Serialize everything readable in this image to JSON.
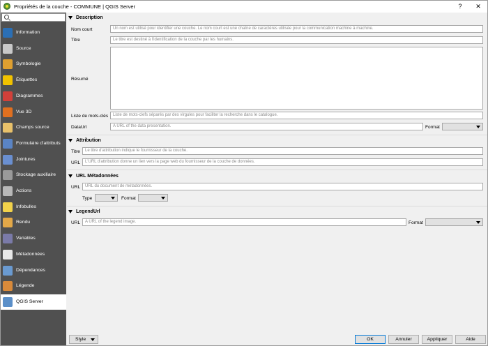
{
  "window": {
    "title": "Propriétés de la couche - COMMUNE | QGIS Server",
    "help_glyph": "?",
    "close_glyph": "✕"
  },
  "sidebar": {
    "search_placeholder": "",
    "items": [
      {
        "label": "Information",
        "icon": "info-icon",
        "color": "#2b6fb5"
      },
      {
        "label": "Source",
        "icon": "source-wrench-icon",
        "color": "#c9c9c9"
      },
      {
        "label": "Symbologie",
        "icon": "symbology-brush-icon",
        "color": "#e0a030"
      },
      {
        "label": "Étiquettes",
        "icon": "labels-abc-icon",
        "color": "#f2c200"
      },
      {
        "label": "Diagrammes",
        "icon": "diagram-icon",
        "color": "#d2403a"
      },
      {
        "label": "Vue 3D",
        "icon": "view-3d-icon",
        "color": "#e07020"
      },
      {
        "label": "Champs source",
        "icon": "source-fields-icon",
        "color": "#e8c16a"
      },
      {
        "label": "Formulaire d'attributs",
        "icon": "attribute-form-icon",
        "color": "#5a84c4"
      },
      {
        "label": "Jointures",
        "icon": "joins-icon",
        "color": "#6a8fd0"
      },
      {
        "label": "Stockage auxiliaire",
        "icon": "auxiliary-storage-icon",
        "color": "#9a9a9a"
      },
      {
        "label": "Actions",
        "icon": "actions-gear-icon",
        "color": "#b8b8b8"
      },
      {
        "label": "Infobulles",
        "icon": "tooltips-bubble-icon",
        "color": "#f2d24a"
      },
      {
        "label": "Rendu",
        "icon": "rendering-brush-icon",
        "color": "#e3a848"
      },
      {
        "label": "Variables",
        "icon": "variables-icon",
        "color": "#7a7aa8"
      },
      {
        "label": "Métadonnées",
        "icon": "metadata-icon",
        "color": "#e8e8e8"
      },
      {
        "label": "Dépendances",
        "icon": "dependencies-icon",
        "color": "#6a9ad0"
      },
      {
        "label": "Légende",
        "icon": "legend-icon",
        "color": "#d98a3a"
      },
      {
        "label": "QGIS Server",
        "icon": "qgis-server-icon",
        "color": "#5b8fc8"
      }
    ],
    "active_index": 17
  },
  "description": {
    "header": "Description",
    "short_name_label": "Nom court",
    "short_name_placeholder": "Un nom est utilisé pour identifier une couche. Le nom court est une chaîne de caractères utilisée pour la communication machine à machine.",
    "title_label": "Titre",
    "title_placeholder": "Le titre est destiné à l'identification de la couche par les humains.",
    "abstract_label": "Résumé",
    "keywords_label": "Liste de mots-clés",
    "keywords_placeholder": "Liste de mots-clefs séparés par des virgules pour faciliter la recherche dans le catalogue.",
    "dataurl_label": "DataUrl",
    "dataurl_placeholder": "A URL of the data presentation.",
    "format_label": "Format"
  },
  "attribution": {
    "header": "Attribution",
    "title_label": "Titre",
    "title_placeholder": "Le titre d'attribution indique le fournisseur de la couche.",
    "url_label": "URL",
    "url_placeholder": "L'URL d'attribution donne un lien vers la page web du fournisseur de la couche de données."
  },
  "metadata_url": {
    "header": "URL Métadonnées",
    "url_label": "URL",
    "url_placeholder": "URL du document de métadonnées.",
    "type_label": "Type",
    "format_label": "Format"
  },
  "legend_url": {
    "header": "LegendUrl",
    "url_label": "URL",
    "url_placeholder": "A URL of the legend image.",
    "format_label": "Format"
  },
  "footer": {
    "style_label": "Style",
    "ok_label": "OK",
    "cancel_label": "Annuler",
    "apply_label": "Appliquer",
    "help_label": "Aide"
  }
}
